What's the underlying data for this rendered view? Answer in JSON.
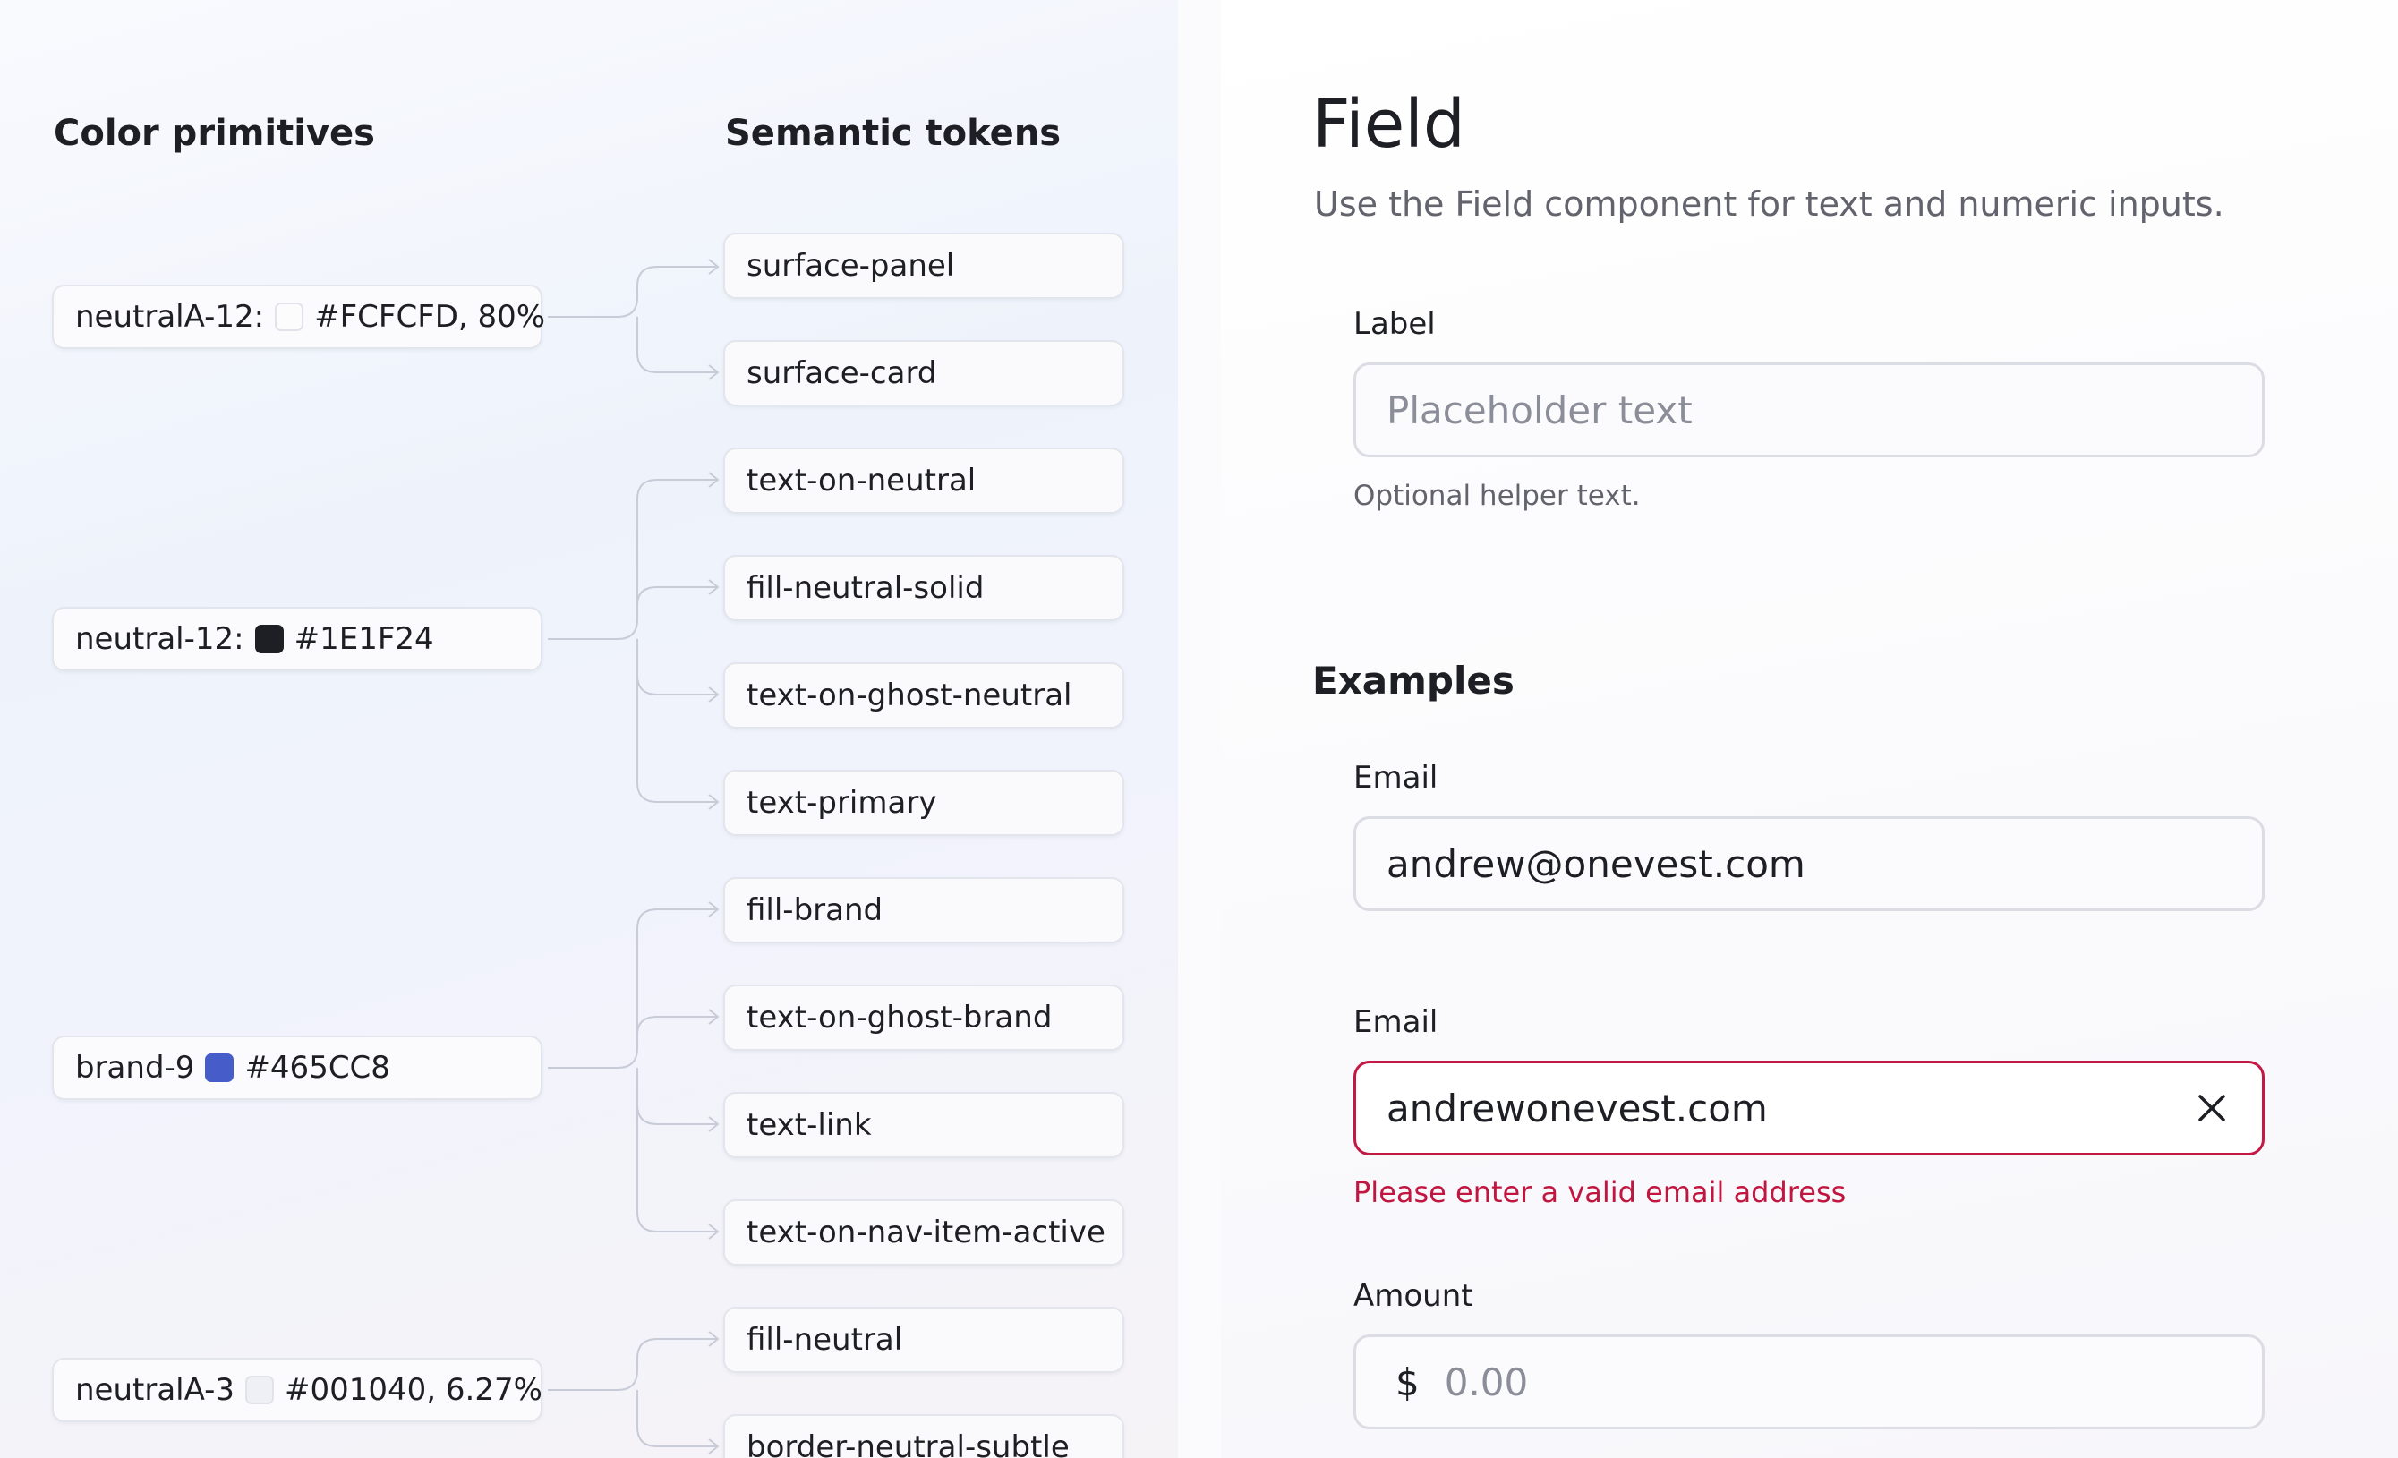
{
  "left": {
    "primitives_heading": "Color primitives",
    "tokens_heading": "Semantic tokens",
    "primitives": [
      {
        "name": "neutralA-12:",
        "value": "#FCFCFD, 80%",
        "swatch": "#FCFCFD"
      },
      {
        "name": "neutral-12:",
        "value": "#1E1F24",
        "swatch": "#1E1F24"
      },
      {
        "name": "brand-9",
        "value": "#465CC8",
        "swatch": "#465CC8"
      },
      {
        "name": "neutralA-3",
        "value": "#001040, 6.27%",
        "swatch": "#eef0f5"
      }
    ],
    "tokens": [
      "surface-panel",
      "surface-card",
      "text-on-neutral",
      "fill-neutral-solid",
      "text-on-ghost-neutral",
      "text-primary",
      "fill-brand",
      "text-on-ghost-brand",
      "text-link",
      "text-on-nav-item-active",
      "fill-neutral",
      "border-neutral-subtle"
    ]
  },
  "right": {
    "title": "Field",
    "subtitle": "Use the Field component for text and numeric inputs.",
    "demo": {
      "label": "Label",
      "placeholder": "Placeholder text",
      "helper": "Optional helper text."
    },
    "examples_heading": "Examples",
    "email_valid": {
      "label": "Email",
      "value": "andrew@onevest.com"
    },
    "email_error": {
      "label": "Email",
      "value": "andrewonevest.com",
      "error": "Please enter a valid email address",
      "clear_icon": "close-icon"
    },
    "amount": {
      "label": "Amount",
      "prefix": "$",
      "placeholder": "0.00"
    }
  },
  "colors": {
    "error": "#c21a44",
    "brand": "#465CC8",
    "neutral_dark": "#1E1F24"
  }
}
